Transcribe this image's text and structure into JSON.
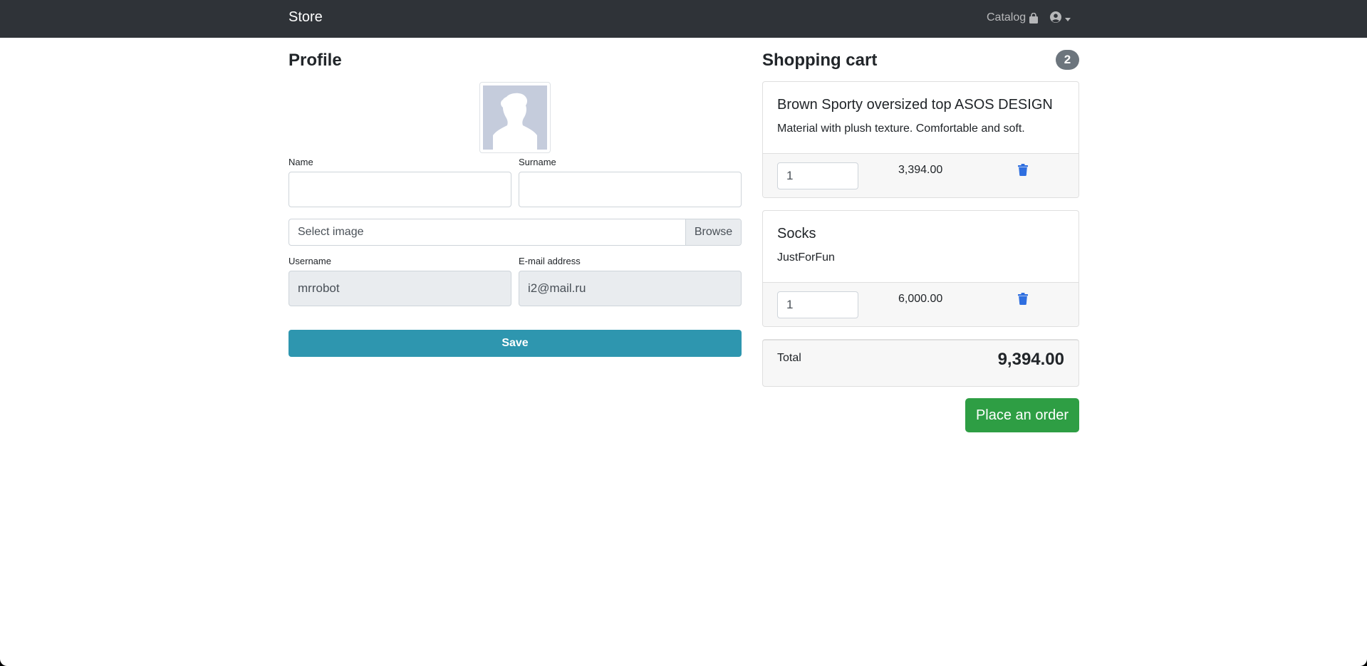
{
  "navbar": {
    "brand": "Store",
    "catalog_label": "Catalog",
    "catalog_icon": "shopping-bag-icon",
    "user_icon": "user-circle-icon"
  },
  "profile": {
    "title": "Profile",
    "name_label": "Name",
    "name_value": "",
    "surname_label": "Surname",
    "surname_value": "",
    "image_placeholder": "Select image",
    "browse_label": "Browse",
    "username_label": "Username",
    "username_value": "mrrobot",
    "email_label": "E-mail address",
    "email_value": "i2@mail.ru",
    "save_label": "Save"
  },
  "cart": {
    "title": "Shopping cart",
    "count": "2",
    "items": [
      {
        "title": "Brown Sporty oversized top ASOS DESIGN",
        "description": "Material with plush texture. Comfortable and soft.",
        "quantity": "1",
        "price": "3,394.00"
      },
      {
        "title": "Socks",
        "description": "JustForFun",
        "quantity": "1",
        "price": "6,000.00"
      }
    ],
    "total_label": "Total",
    "total_value": "9,394.00",
    "order_label": "Place an order"
  },
  "colors": {
    "navbar": "#2f3338",
    "save_button": "#2e96af",
    "order_button": "#2e9e44",
    "badge": "#6c757d",
    "trash_icon": "#2f6fe0"
  }
}
